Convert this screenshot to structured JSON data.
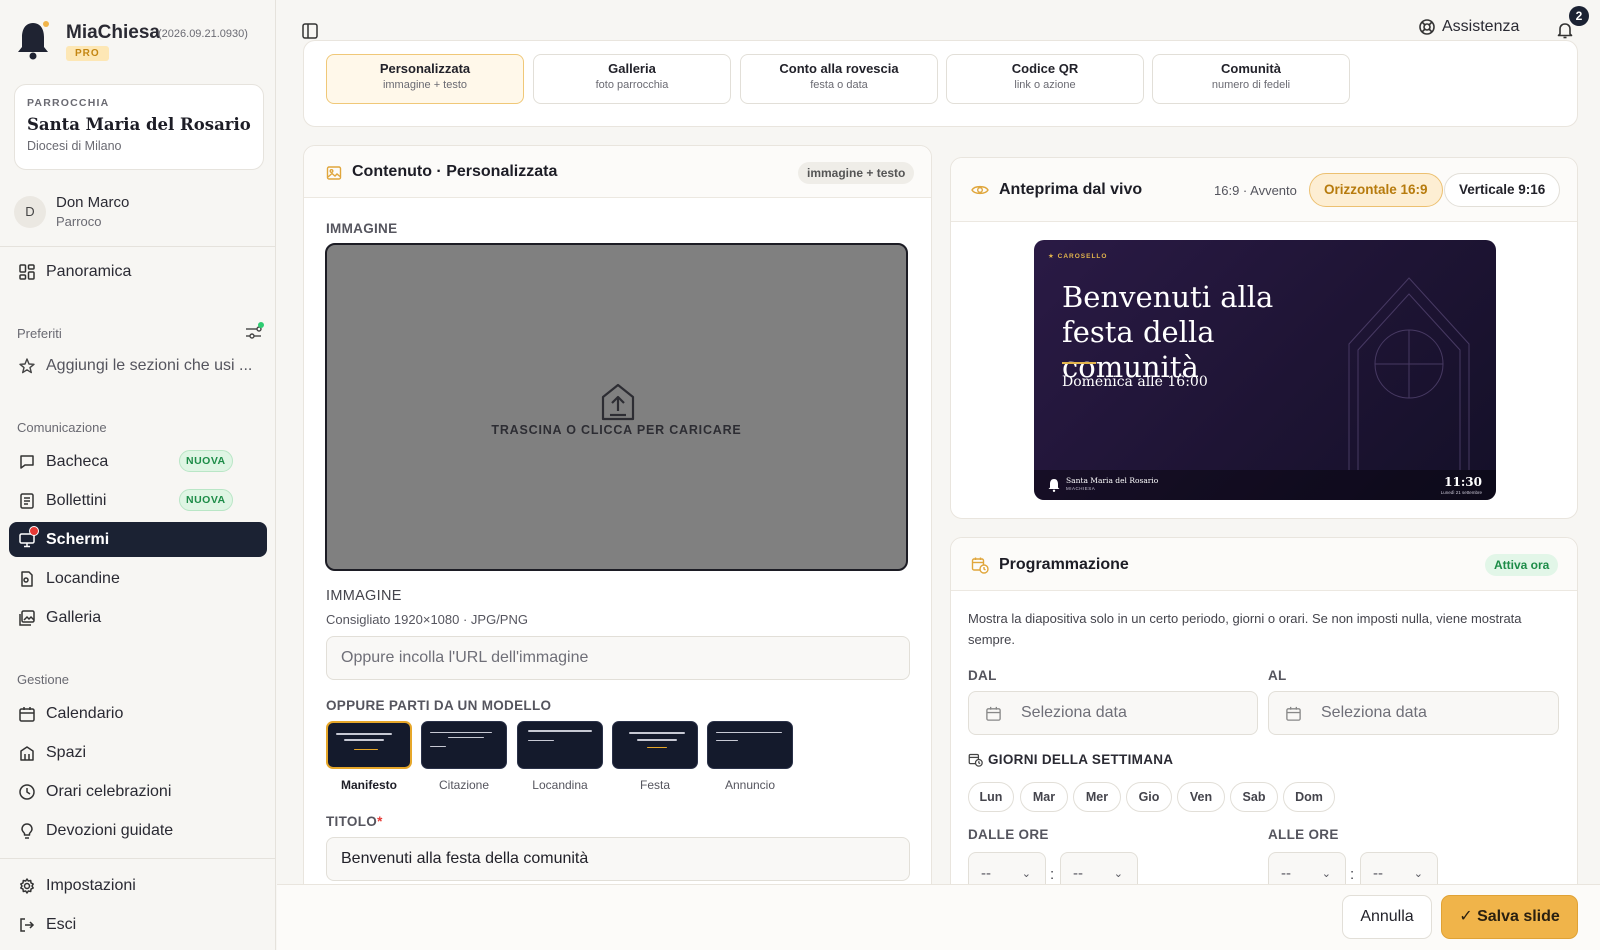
{
  "app": {
    "name": "MiaChiesa",
    "version": "(2026.09.21.0930)",
    "plan": "PRO"
  },
  "parish": {
    "label": "PARROCCHIA",
    "name": "Santa Maria del Rosario",
    "diocese": "Diocesi di Milano"
  },
  "user": {
    "initial": "D",
    "name": "Don Marco",
    "role": "Parroco"
  },
  "nav": {
    "overview": "Panoramica",
    "favorites_label": "Preferiti",
    "favorites_hint": "Aggiungi le sezioni che usi ...",
    "communication_label": "Comunicazione",
    "communication": [
      {
        "label": "Bacheca",
        "badge": "NUOVA"
      },
      {
        "label": "Bollettini",
        "badge": "NUOVA"
      },
      {
        "label": "Schermi"
      },
      {
        "label": "Locandine"
      },
      {
        "label": "Galleria"
      }
    ],
    "management_label": "Gestione",
    "management": [
      {
        "label": "Calendario"
      },
      {
        "label": "Spazi"
      },
      {
        "label": "Orari celebrazioni"
      },
      {
        "label": "Devozioni guidate"
      }
    ],
    "settings": "Impostazioni",
    "logout": "Esci"
  },
  "topbar": {
    "help": "Assistenza",
    "notifications": "2"
  },
  "slide_types": [
    {
      "title": "Personalizzata",
      "subtitle": "immagine + testo"
    },
    {
      "title": "Galleria",
      "subtitle": "foto parrocchia"
    },
    {
      "title": "Conto alla rovescia",
      "subtitle": "festa o data"
    },
    {
      "title": "Codice QR",
      "subtitle": "link o azione"
    },
    {
      "title": "Comunità",
      "subtitle": "numero di fedeli"
    }
  ],
  "content": {
    "title": "Contenuto · Personalizzata",
    "tag": "immagine + testo",
    "image_label": "IMMAGINE",
    "drop_text": "TRASCINA O CLICCA PER CARICARE",
    "image_label2": "IMMAGINE",
    "image_hint": "Consigliato 1920×1080 · JPG/PNG",
    "url_placeholder": "Oppure incolla l'URL dell'immagine",
    "template_label": "OPPURE PARTI DA UN MODELLO",
    "templates": [
      "Manifesto",
      "Citazione",
      "Locandina",
      "Festa",
      "Annuncio"
    ],
    "title_label": "TITOLO",
    "required_mark": "*",
    "title_value": "Benvenuti alla festa della comunità"
  },
  "preview": {
    "title": "Anteprima dal vivo",
    "meta": "16:9 · Avvento",
    "horizontal": "Orizzontale 16:9",
    "vertical": "Verticale 9:16",
    "kicker": "★ CAROSELLO",
    "slide_title": "Benvenuti alla festa della comunità",
    "slide_sub": "Domenica alle 16:00",
    "footer_parish": "Santa Maria del Rosario",
    "footer_app": "MIACHIESA",
    "footer_time": "11:30",
    "footer_date": "Lunedì 21 settembre"
  },
  "schedule": {
    "title": "Programmazione",
    "status": "Attiva ora",
    "desc": "Mostra la diapositiva solo in un certo periodo, giorni o orari. Se non imposti nulla, viene mostrata sempre.",
    "from_label": "DAL",
    "to_label": "AL",
    "date_placeholder": "Seleziona data",
    "days_label": "GIORNI DELLA SETTIMANA",
    "days": [
      "Lun",
      "Mar",
      "Mer",
      "Gio",
      "Ven",
      "Sab",
      "Dom"
    ],
    "from_time_label": "DALLE ORE",
    "to_time_label": "ALLE ORE",
    "time_placeholder": "--"
  },
  "footer": {
    "cancel": "Annulla",
    "save": "Salva slide"
  },
  "colors": {
    "accent": "#f0b44a",
    "active_nav": "#1b2233",
    "success": "#1d8c48"
  }
}
